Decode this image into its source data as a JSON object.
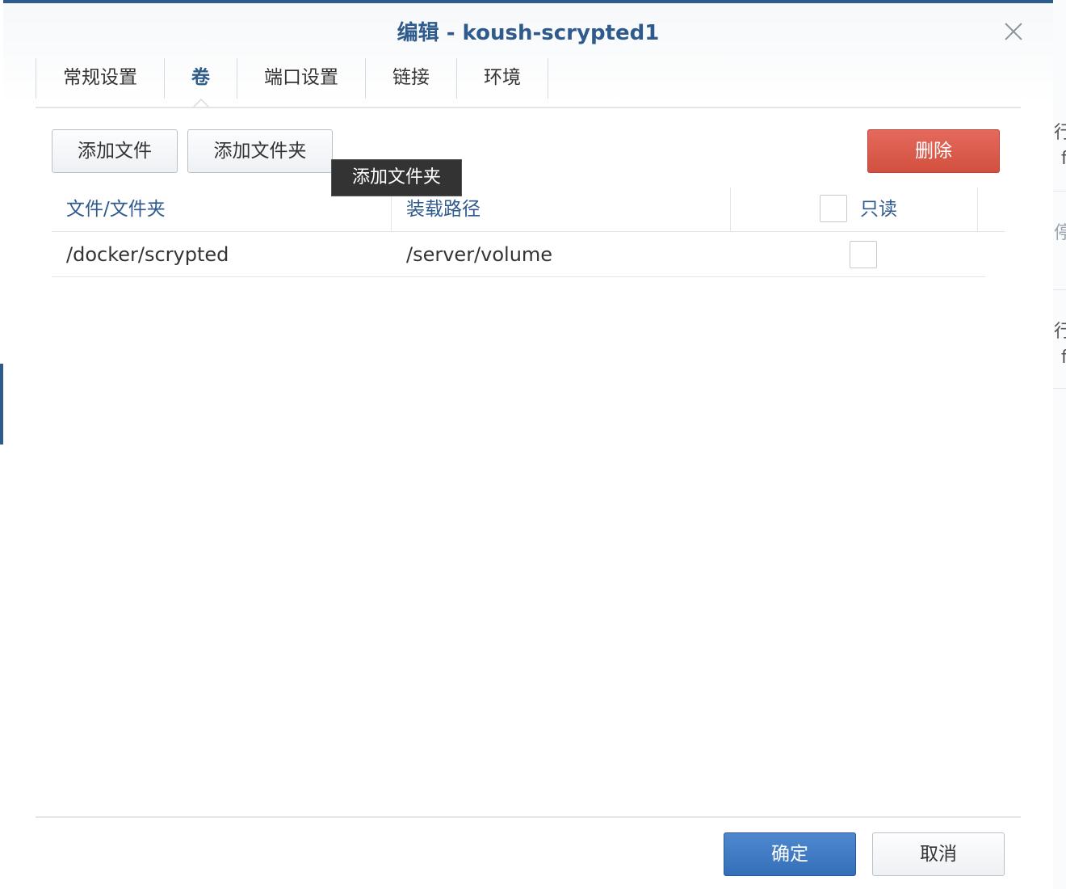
{
  "dialog": {
    "title": "编辑 - koush-scrypted1"
  },
  "tabs": [
    {
      "label": "常规设置",
      "active": false
    },
    {
      "label": "卷",
      "active": true
    },
    {
      "label": "端口设置",
      "active": false
    },
    {
      "label": "链接",
      "active": false
    },
    {
      "label": "环境",
      "active": false
    }
  ],
  "toolbar": {
    "add_file_label": "添加文件",
    "add_folder_label": "添加文件夹",
    "delete_label": "删除",
    "tooltip": "添加文件夹"
  },
  "grid": {
    "columns": [
      "文件/文件夹",
      "装载路径",
      "只读"
    ],
    "rows": [
      {
        "path": "/docker/scrypted",
        "mount": "/server/volume",
        "readonly": false
      }
    ],
    "header_check_all": false
  },
  "footer": {
    "ok_label": "确定",
    "cancel_label": "取消"
  },
  "background": {
    "glyphs": [
      "行",
      "f",
      "停",
      "行",
      "f"
    ]
  },
  "colors": {
    "accent": "#2f5a8c",
    "delete": "#d9594b",
    "primary": "#3a76c0"
  }
}
